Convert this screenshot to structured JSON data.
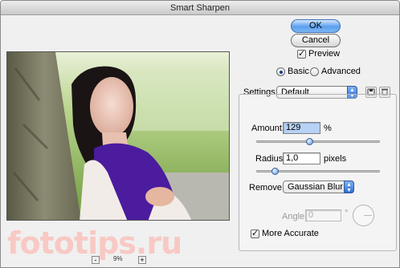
{
  "window": {
    "title": "Smart Sharpen"
  },
  "buttons": {
    "ok": "OK",
    "cancel": "Cancel"
  },
  "preview": {
    "label": "Preview",
    "checked": true
  },
  "mode": {
    "basic": "Basic",
    "advanced": "Advanced",
    "selected": "basic"
  },
  "settings": {
    "label": "Settings:",
    "value": "Default"
  },
  "amount": {
    "label": "Amount:",
    "value": "129",
    "unit": "%",
    "level": 0.43
  },
  "radius": {
    "label": "Radius:",
    "value": "1,0",
    "unit": "pixels",
    "level": 0.13
  },
  "remove": {
    "label": "Remove:",
    "value": "Gaussian Blur"
  },
  "angle": {
    "label": "Angle:",
    "value": "0",
    "unit": "°"
  },
  "more_accurate": {
    "label": "More Accurate",
    "checked": true
  },
  "zoom": {
    "value": "9%",
    "minus": "-",
    "plus": "+"
  },
  "watermark": {
    "text": "fototips.ru"
  },
  "icons": [
    "save-preset-icon",
    "delete-preset-icon",
    "minus-icon",
    "plus-icon"
  ]
}
